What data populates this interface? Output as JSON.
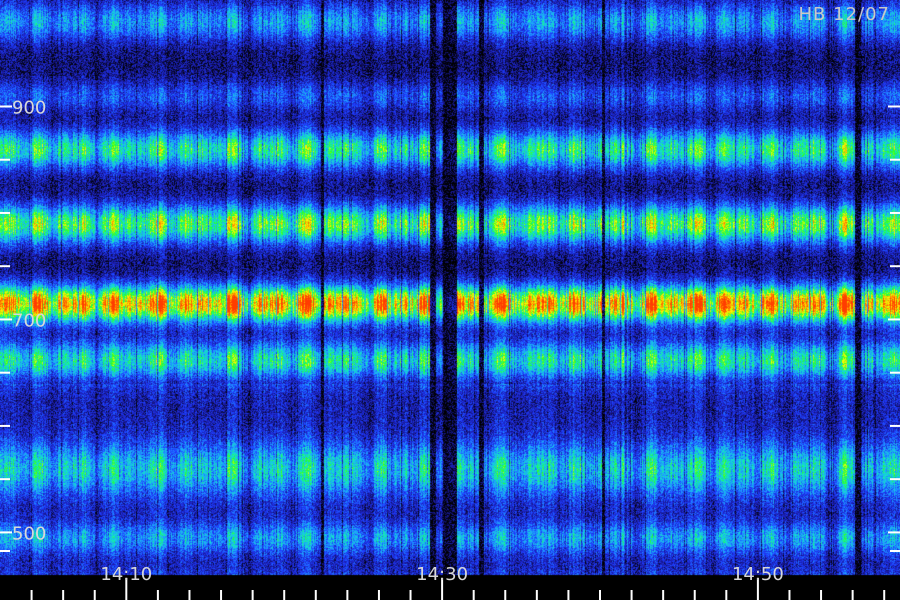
{
  "badge": "HB 12/07",
  "chart_data": {
    "type": "heatmap",
    "title": "",
    "xlabel": "",
    "ylabel": "",
    "x_range": [
      "14:02",
      "14:59"
    ],
    "y_range": [
      460,
      1000
    ],
    "x_tick_labels": [
      {
        "label": "14:10",
        "value": 10
      },
      {
        "label": "14:30",
        "value": 30
      },
      {
        "label": "14:50",
        "value": 50
      }
    ],
    "x_minor_ticks": [
      4,
      6,
      8,
      12,
      14,
      16,
      18,
      20,
      22,
      24,
      26,
      28,
      32,
      34,
      36,
      38,
      40,
      42,
      44,
      46,
      48,
      52,
      54,
      56,
      58
    ],
    "y_tick_labels": [
      {
        "label": "900",
        "value": 900
      },
      {
        "label": "700",
        "value": 700
      },
      {
        "label": "500",
        "value": 500
      }
    ],
    "y_minor_ticks": [
      850,
      800,
      750,
      650,
      600,
      550,
      450
    ],
    "bands": [
      {
        "center": 980,
        "width": 18,
        "intensity": 0.35
      },
      {
        "center": 910,
        "width": 14,
        "intensity": 0.22
      },
      {
        "center": 860,
        "width": 18,
        "intensity": 0.55
      },
      {
        "center": 790,
        "width": 18,
        "intensity": 0.65
      },
      {
        "center": 715,
        "width": 17,
        "intensity": 0.95
      },
      {
        "center": 662,
        "width": 18,
        "intensity": 0.52
      },
      {
        "center": 560,
        "width": 24,
        "intensity": 0.38
      },
      {
        "center": 495,
        "width": 14,
        "intensity": 0.28
      },
      {
        "center": 440,
        "width": 16,
        "intensity": 0.42
      }
    ],
    "gaps": [
      {
        "from": 22.3,
        "to": 22.5
      },
      {
        "from": 29.2,
        "to": 29.6
      },
      {
        "from": 30.0,
        "to": 30.9
      },
      {
        "from": 32.3,
        "to": 32.6
      },
      {
        "from": 40.1,
        "to": 40.3
      },
      {
        "from": 56.1,
        "to": 56.5
      }
    ],
    "colormap": [
      "#000000",
      "#1a1aa0",
      "#1e3cff",
      "#1ea0ff",
      "#12e6c8",
      "#28ff28",
      "#ffff00",
      "#ff8c00",
      "#ff3c00"
    ],
    "grid": false,
    "legend": "none"
  }
}
